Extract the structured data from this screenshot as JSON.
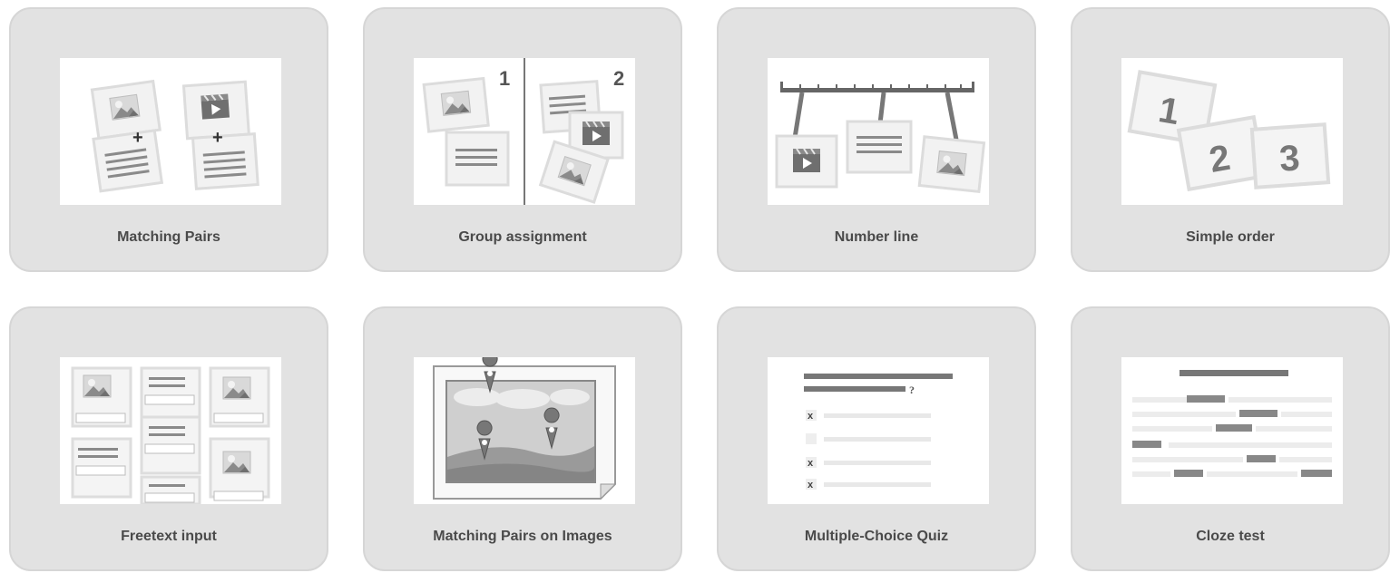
{
  "tiles": [
    {
      "label": "Matching Pairs",
      "icon": "matching-pairs-icon"
    },
    {
      "label": "Group assignment",
      "icon": "group-assignment-icon",
      "group_numbers": [
        "1",
        "2"
      ]
    },
    {
      "label": "Number line",
      "icon": "number-line-icon"
    },
    {
      "label": "Simple order",
      "icon": "simple-order-icon",
      "order_numbers": [
        "1",
        "2",
        "3"
      ]
    },
    {
      "label": "Freetext input",
      "icon": "freetext-input-icon"
    },
    {
      "label": "Matching Pairs on Images",
      "icon": "matching-pairs-on-images-icon"
    },
    {
      "label": "Multiple-Choice Quiz",
      "icon": "multiple-choice-quiz-icon",
      "question_mark": "?",
      "marks": [
        "x",
        "",
        "x",
        "x"
      ]
    },
    {
      "label": "Cloze test",
      "icon": "cloze-test-icon"
    }
  ],
  "colors": {
    "card_bg": "#e2e2e2",
    "card_border": "#d6d6d6",
    "thumb_bg": "#ffffff",
    "label_text": "#4a4a4a",
    "icon_dark": "#777777",
    "icon_light": "#eeeeee"
  }
}
